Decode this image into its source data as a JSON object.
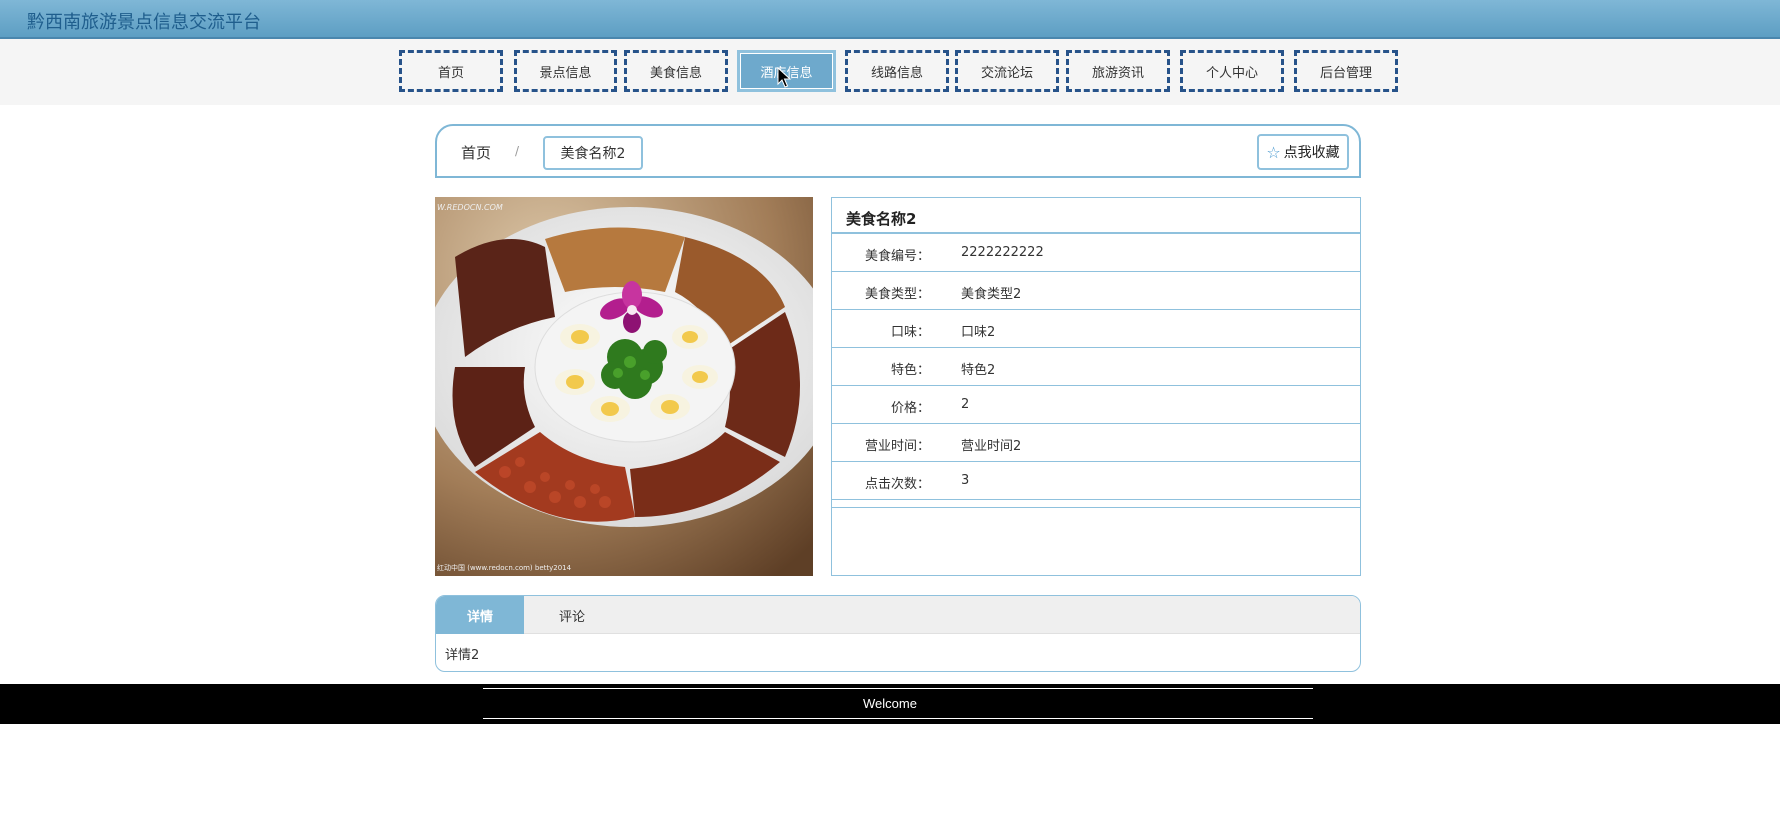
{
  "header": {
    "site_title": "黔西南旅游景点信息交流平台"
  },
  "nav": {
    "items": [
      {
        "label": "首页"
      },
      {
        "label": "景点信息"
      },
      {
        "label": "美食信息"
      },
      {
        "label": "酒店信息"
      },
      {
        "label": "线路信息"
      },
      {
        "label": "交流论坛"
      },
      {
        "label": "旅游资讯"
      },
      {
        "label": "个人中心"
      },
      {
        "label": "后台管理"
      }
    ],
    "active_index": 3
  },
  "breadcrumb": {
    "home": "首页",
    "separator": "/",
    "current": "美食名称2"
  },
  "favorite_button": {
    "label": "点我收藏",
    "icon": "star-outline-icon"
  },
  "photo": {
    "watermark_top": "W.REDOCN.COM",
    "watermark_bottom": "红动中国 (www.redocn.com)    betty2014"
  },
  "detail": {
    "title": "美食名称2",
    "rows": [
      {
        "label": "美食编号：",
        "value": "2222222222"
      },
      {
        "label": "美食类型：",
        "value": "美食类型2"
      },
      {
        "label": "口味：",
        "value": "口味2"
      },
      {
        "label": "特色：",
        "value": "特色2"
      },
      {
        "label": "价格：",
        "value": "2"
      },
      {
        "label": "营业时间：",
        "value": "营业时间2"
      },
      {
        "label": "点击次数：",
        "value": "3"
      }
    ]
  },
  "tabs": {
    "items": [
      {
        "label": "详情"
      },
      {
        "label": "评论"
      }
    ],
    "active_index": 0,
    "content": "详情2"
  },
  "footer": {
    "text": "Welcome"
  },
  "colors": {
    "accent": "#7fb7d6",
    "nav_border": "#27538a",
    "title_text": "#1f5e8d"
  }
}
